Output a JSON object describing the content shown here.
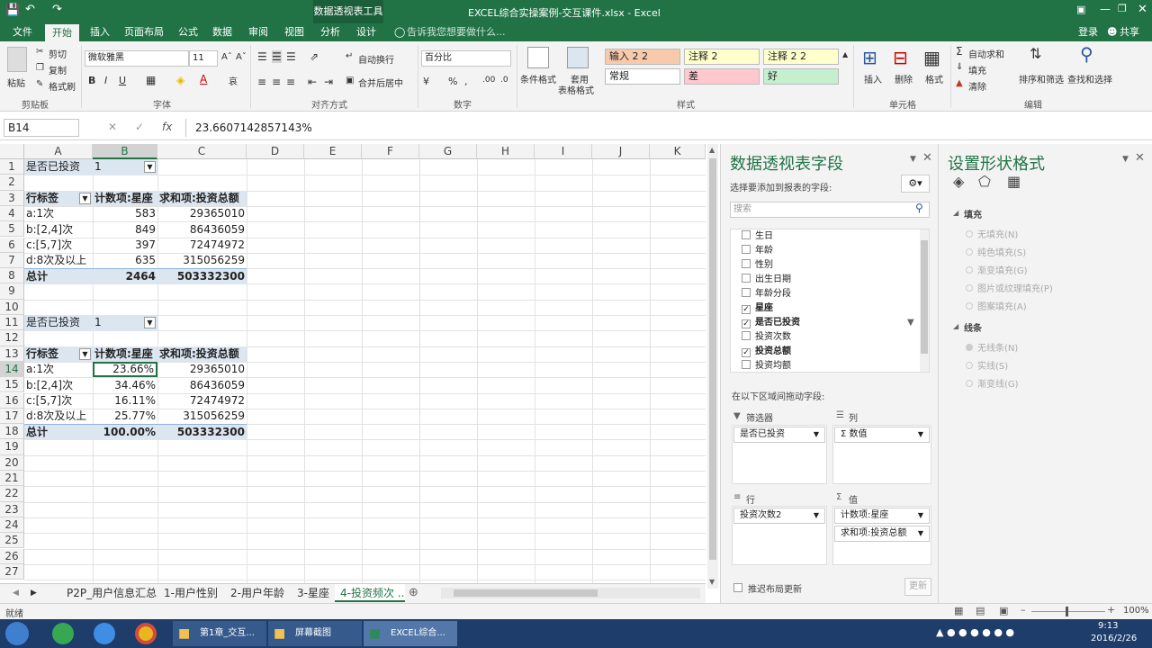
{
  "window": {
    "context_tool": "数据透视表工具",
    "title": "EXCEL综合实操案例-交互课件.xlsx - Excel"
  },
  "ribbon_tabs": [
    "文件",
    "开始",
    "插入",
    "页面布局",
    "公式",
    "数据",
    "审阅",
    "视图",
    "分析",
    "设计"
  ],
  "tell_me": "告诉我您想要做什么...",
  "account": {
    "signin": "登录",
    "share": "共享"
  },
  "ribbon": {
    "clipboard": {
      "paste": "粘贴",
      "cut": "剪切",
      "copy": "复制",
      "format_painter": "格式刷",
      "label": "剪贴板"
    },
    "font": {
      "name": "微软雅黑",
      "size": "11",
      "bold": "B",
      "italic": "I",
      "underline": "U",
      "label": "字体"
    },
    "alignment": {
      "wrap": "自动换行",
      "merge": "合并后居中",
      "label": "对齐方式"
    },
    "number": {
      "format": "百分比",
      "label": "数字"
    },
    "styles": {
      "conditional": "条件格式",
      "table_format_1": "套用",
      "table_format_2": "表格格式",
      "cells": [
        {
          "text": "输入 2 2",
          "bg": "#f7caac"
        },
        {
          "text": "注释 2",
          "bg": "#ffffcc"
        },
        {
          "text": "注释 2 2",
          "bg": "#ffffcc"
        },
        {
          "text": "常规",
          "bg": "#ffffff"
        },
        {
          "text": "差",
          "bg": "#ffc7ce"
        },
        {
          "text": "好",
          "bg": "#c6efce"
        }
      ],
      "label": "样式"
    },
    "cells_group": {
      "insert": "插入",
      "delete": "删除",
      "format": "格式",
      "label": "单元格"
    },
    "editing": {
      "autosum": "自动求和",
      "fill": "填充",
      "clear": "清除",
      "sort": "排序和筛选",
      "find": "查找和选择",
      "label": "编辑"
    }
  },
  "formula_bar": {
    "name_box": "B14",
    "fx": "fx",
    "value": "23.6607142857143%"
  },
  "columns": [
    "A",
    "B",
    "C",
    "D",
    "E",
    "F",
    "G",
    "H",
    "I",
    "J",
    "K"
  ],
  "rows": [
    "1",
    "2",
    "3",
    "4",
    "5",
    "6",
    "7",
    "8",
    "9",
    "10",
    "11",
    "12",
    "13",
    "14",
    "15",
    "16",
    "17",
    "18",
    "19",
    "20",
    "21",
    "22",
    "23",
    "24",
    "25",
    "26",
    "27"
  ],
  "pivot1": {
    "filter_label": "是否已投资",
    "filter_value": "1",
    "headers": [
      "行标签",
      "计数项:星座",
      "求和项:投资总额"
    ],
    "rows": [
      [
        "a:1次",
        "583",
        "29365010"
      ],
      [
        "b:[2,4]次",
        "849",
        "86436059"
      ],
      [
        "c:[5,7]次",
        "397",
        "72474972"
      ],
      [
        "d:8次及以上",
        "635",
        "315056259"
      ]
    ],
    "total": [
      "总计",
      "2464",
      "503332300"
    ]
  },
  "pivot2": {
    "filter_label": "是否已投资",
    "filter_value": "1",
    "headers": [
      "行标签",
      "计数项:星座",
      "求和项:投资总额"
    ],
    "rows": [
      [
        "a:1次",
        "23.66%",
        "29365010"
      ],
      [
        "b:[2,4]次",
        "34.46%",
        "86436059"
      ],
      [
        "c:[5,7]次",
        "16.11%",
        "72474972"
      ],
      [
        "d:8次及以上",
        "25.77%",
        "315056259"
      ]
    ],
    "total": [
      "总计",
      "100.00%",
      "503332300"
    ]
  },
  "sheet_tabs": [
    "P2P_用户信息汇总",
    "1-用户性别",
    "2-用户年龄",
    "3-星座",
    "4-投资频次 ..."
  ],
  "status": {
    "ready": "就绪",
    "zoom": "100%"
  },
  "pivot_panel": {
    "title": "数据透视表字段",
    "subtitle": "选择要添加到报表的字段:",
    "search_placeholder": "搜索",
    "fields": [
      {
        "name": "生日",
        "checked": false
      },
      {
        "name": "年龄",
        "checked": false
      },
      {
        "name": "性别",
        "checked": false
      },
      {
        "name": "出生日期",
        "checked": false
      },
      {
        "name": "年龄分段",
        "checked": false
      },
      {
        "name": "星座",
        "checked": true
      },
      {
        "name": "是否已投资",
        "checked": true
      },
      {
        "name": "投资次数",
        "checked": false
      },
      {
        "name": "投资总额",
        "checked": true
      },
      {
        "name": "投资均额",
        "checked": false
      }
    ],
    "drag_label": "在以下区域间拖动字段:",
    "filters_label": "筛选器",
    "columns_label": "列",
    "rows_label": "行",
    "values_label": "值",
    "filter_item": "是否已投资",
    "column_item": "Σ 数值",
    "row_item": "投资次数2",
    "value_items": [
      "计数项:星座",
      "求和项:投资总额"
    ],
    "defer": "推迟布局更新",
    "update": "更新"
  },
  "shape_panel": {
    "title": "设置形状格式",
    "fill_title": "填充",
    "fill_options": [
      "无填充(N)",
      "纯色填充(S)",
      "渐变填充(G)",
      "图片或纹理填充(P)",
      "图案填充(A)"
    ],
    "line_title": "线条",
    "line_options": [
      "无线条(N)",
      "实线(S)",
      "渐变线(G)"
    ]
  },
  "taskbar": {
    "apps": [
      "第1章_交互...",
      "屏幕截图",
      "EXCEL综合..."
    ],
    "time": "9:13",
    "date": "2016/2/26"
  }
}
